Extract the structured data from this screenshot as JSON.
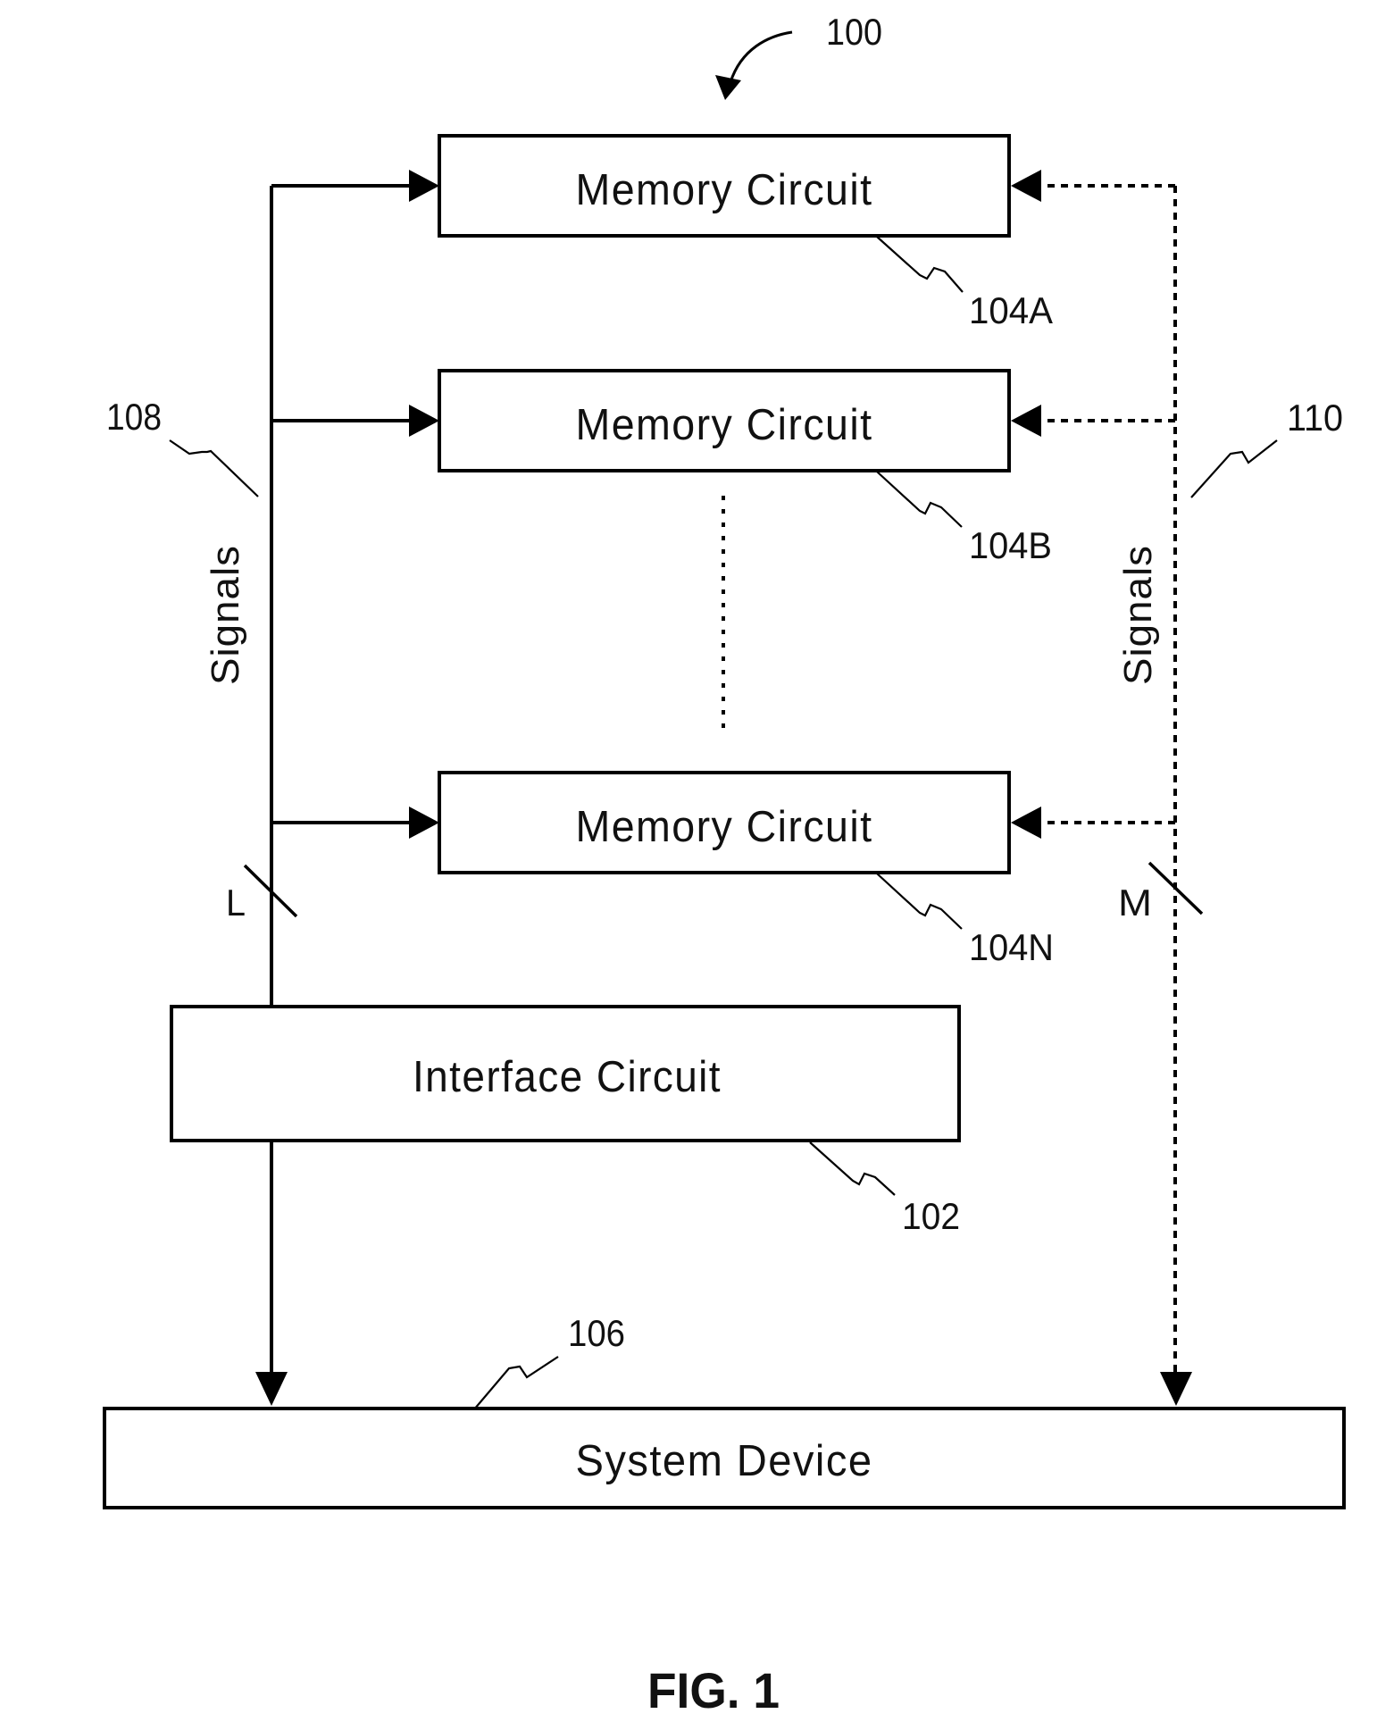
{
  "figure": {
    "ref_number": "100",
    "caption": "FIG. 1"
  },
  "memory_circuits": [
    {
      "label": "Memory Circuit",
      "ref": "104A"
    },
    {
      "label": "Memory Circuit",
      "ref": "104B"
    },
    {
      "label": "Memory Circuit",
      "ref": "104N"
    }
  ],
  "interface_circuit": {
    "label": "Interface Circuit",
    "ref": "102"
  },
  "system_device": {
    "label": "System Device",
    "ref": "106"
  },
  "bus_left": {
    "ref": "108",
    "label": "Signals",
    "width_label": "L",
    "line_style": "solid"
  },
  "bus_right": {
    "ref": "110",
    "label": "Signals",
    "width_label": "M",
    "line_style": "dashed"
  },
  "colors": {
    "ink": "#000000",
    "background": "#ffffff"
  }
}
